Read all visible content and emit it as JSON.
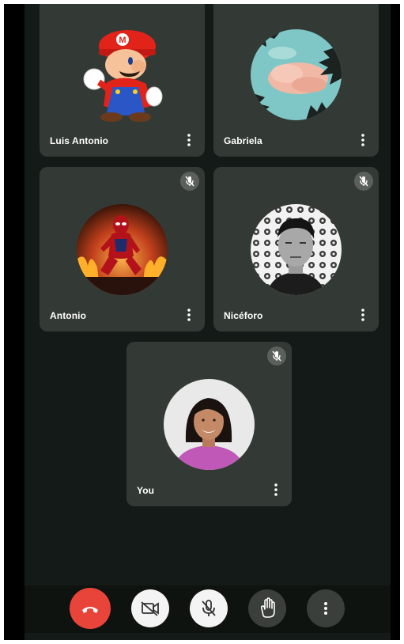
{
  "participants": [
    {
      "name": "Luis Antonio",
      "avatar": "mario-avatar",
      "muted": false
    },
    {
      "name": "Gabriela",
      "avatar": "clouds-palms-avatar",
      "muted": false
    },
    {
      "name": "Antonio",
      "avatar": "spiderman-fire-avatar",
      "muted": true
    },
    {
      "name": "Nicéforo",
      "avatar": "portrait-avatar",
      "muted": true
    },
    {
      "name": "You",
      "avatar": "woman-portrait-avatar",
      "muted": true
    }
  ],
  "controls": [
    {
      "id": "end-call",
      "icon": "phone-hangup-icon",
      "color": "#e9443a"
    },
    {
      "id": "camera",
      "icon": "camera-off-icon",
      "color": "#f4f4f4"
    },
    {
      "id": "microphone",
      "icon": "mic-off-icon",
      "color": "#f4f4f4"
    },
    {
      "id": "raise-hand",
      "icon": "hand-icon",
      "color": "#3a3f3c"
    },
    {
      "id": "more-options",
      "icon": "more-vertical-icon",
      "color": "#3a3f3c"
    }
  ],
  "colors": {
    "tile_bg": "#333a35",
    "screen_bg": "#141a17",
    "end_call": "#e9443a"
  }
}
